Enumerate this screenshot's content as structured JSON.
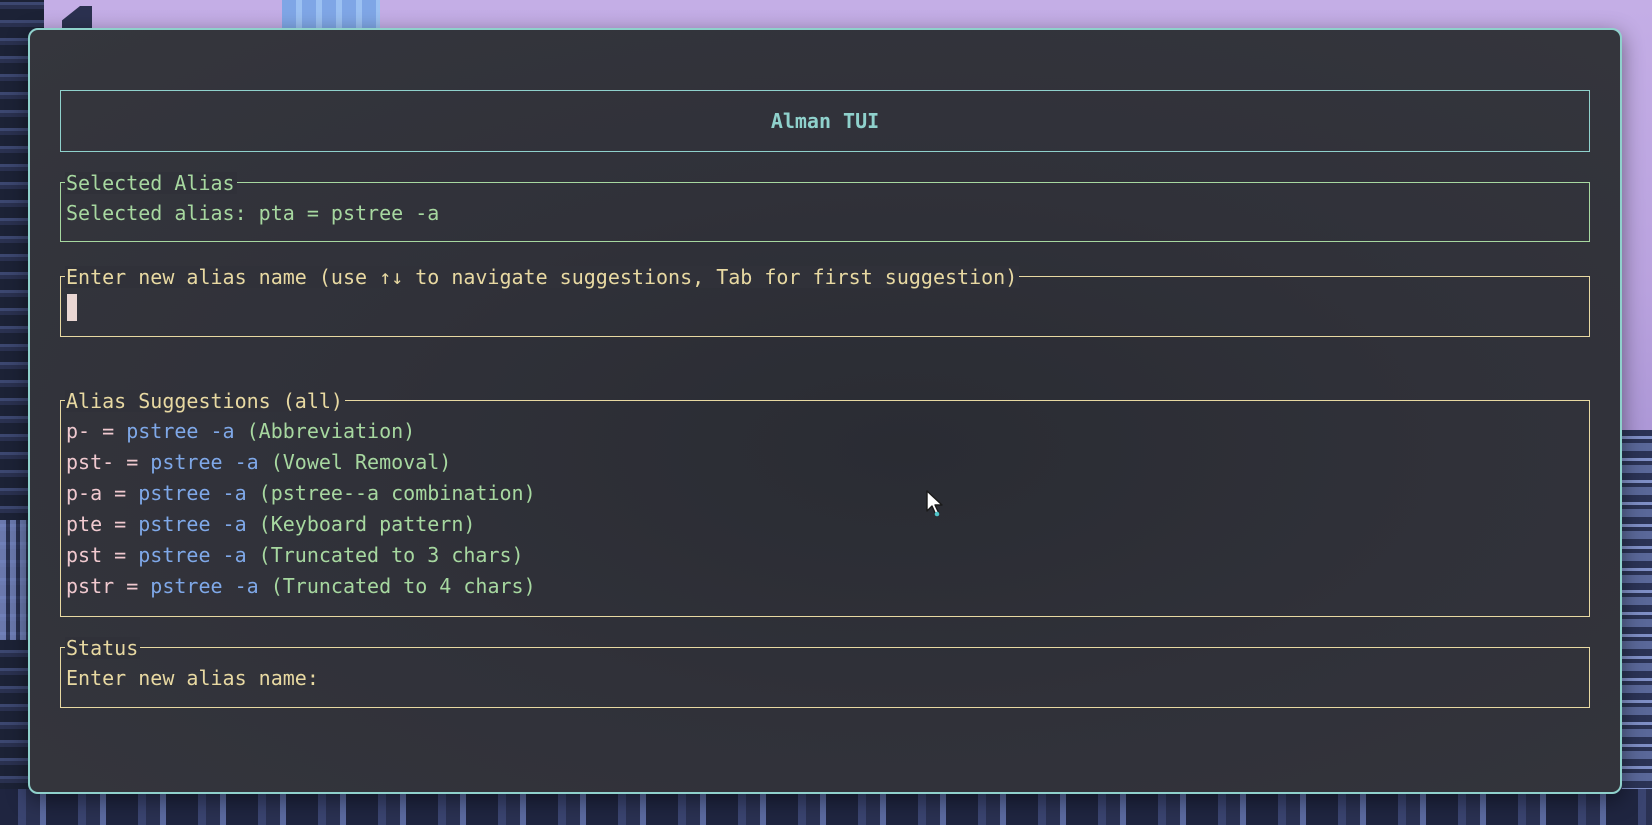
{
  "app": {
    "title": "Alman TUI"
  },
  "selected_alias": {
    "legend": "Selected Alias",
    "text": "Selected alias: pta = pstree -a"
  },
  "input": {
    "legend": "Enter new alias name (use ↑↓ to navigate suggestions, Tab for first suggestion)",
    "value": ""
  },
  "suggestions": {
    "legend": "Alias Suggestions (all)",
    "items": [
      {
        "alias": "p-",
        "command": "pstree -a",
        "reason": "(Abbreviation)"
      },
      {
        "alias": "pst-",
        "command": "pstree -a",
        "reason": "(Vowel Removal)"
      },
      {
        "alias": "p-a",
        "command": "pstree -a",
        "reason": "(pstree--a combination)"
      },
      {
        "alias": "pte",
        "command": "pstree -a",
        "reason": "(Keyboard pattern)"
      },
      {
        "alias": "pst",
        "command": "pstree -a",
        "reason": "(Truncated to 3 chars)"
      },
      {
        "alias": "pstr",
        "command": "pstree -a",
        "reason": "(Truncated to 4 chars)"
      }
    ],
    "separator": " = "
  },
  "status": {
    "legend": "Status",
    "text": "Enter new alias name:"
  },
  "colors": {
    "accent_teal": "#8fd1cc",
    "alias_pink": "#f0c9cf",
    "command_blue": "#7fa8e8",
    "reason_green": "#a7d8a0",
    "border_yellow": "#e8d9a2",
    "background": "#303139"
  }
}
